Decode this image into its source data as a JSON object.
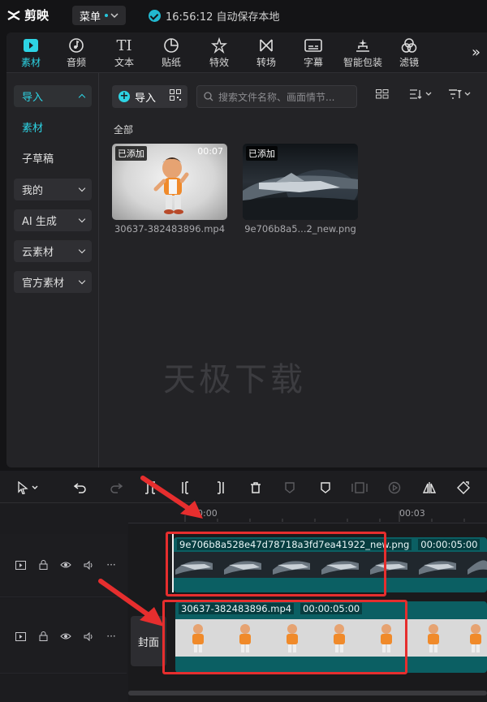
{
  "app": {
    "logo_text": "剪映",
    "menu_label": "菜单",
    "autosave_text": "16:56:12 自动保存本地"
  },
  "tabs": [
    {
      "label": "素材",
      "icon": "media-icon",
      "active": true
    },
    {
      "label": "音频",
      "icon": "audio-icon"
    },
    {
      "label": "文本",
      "icon": "text-icon"
    },
    {
      "label": "贴纸",
      "icon": "sticker-icon"
    },
    {
      "label": "特效",
      "icon": "effects-icon"
    },
    {
      "label": "转场",
      "icon": "transition-icon"
    },
    {
      "label": "字幕",
      "icon": "subtitle-icon"
    },
    {
      "label": "智能包装",
      "icon": "smart-pack-icon"
    },
    {
      "label": "滤镜",
      "icon": "filter-icon"
    }
  ],
  "tabs_more": "»",
  "sidebar": {
    "items": [
      {
        "label": "导入",
        "type": "group-open"
      },
      {
        "label": "素材",
        "type": "sub-active"
      },
      {
        "label": "子草稿",
        "type": "sub"
      },
      {
        "label": "我的",
        "type": "group"
      },
      {
        "label": "AI 生成",
        "type": "group"
      },
      {
        "label": "云素材",
        "type": "group"
      },
      {
        "label": "官方素材",
        "type": "group"
      }
    ]
  },
  "content": {
    "import_label": "导入",
    "search_placeholder": "搜索文件名称、画面情节...",
    "section_label": "全部",
    "media": [
      {
        "badge": "已添加",
        "duration": "00:07",
        "name": "30637-382483896.mp4"
      },
      {
        "badge": "已添加",
        "duration": "",
        "name": "9e706b8a5...2_new.png"
      }
    ],
    "watermark": "天极下载"
  },
  "timeline": {
    "ruler": [
      "00:00",
      "00:03"
    ],
    "tracks": [
      {
        "name": "9e706b8a528e47d78718a3fd7ea41922_new.png",
        "duration": "00:00:05:00"
      },
      {
        "name": "30637-382483896.mp4",
        "duration": "00:00:05:00"
      }
    ],
    "cover_label": "封面"
  },
  "colors": {
    "accent": "#2dd4e4",
    "clip_teal": "#0b5f63",
    "highlight": "#e62e2e"
  }
}
